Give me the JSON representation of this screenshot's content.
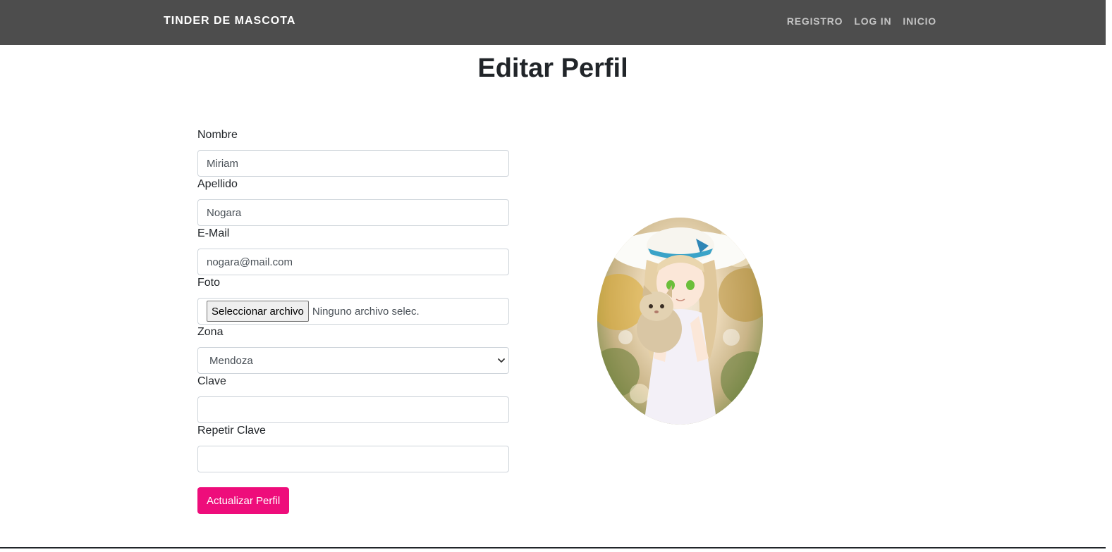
{
  "navbar": {
    "brand": "TINDER DE MASCOTA",
    "links": [
      "REGISTRO",
      "LOG IN",
      "INICIO"
    ]
  },
  "page_title": "Editar Perfil",
  "form": {
    "nombre": {
      "label": "Nombre",
      "value": "Miriam"
    },
    "apellido": {
      "label": "Apellido",
      "value": "Nogara"
    },
    "email": {
      "label": "E-Mail",
      "value": "nogara@mail.com"
    },
    "foto": {
      "label": "Foto",
      "button_label": "Seleccionar archivo",
      "status": "Ninguno archivo selec."
    },
    "zona": {
      "label": "Zona",
      "value": "Mendoza"
    },
    "clave": {
      "label": "Clave",
      "value": ""
    },
    "repetir_clave": {
      "label": "Repetir Clave",
      "value": ""
    },
    "submit_label": "Actualizar Perfil"
  },
  "colors": {
    "navbar_bg": "#4d4d4d",
    "accent": "#ee0d7b"
  },
  "icons": {
    "select_arrow": "chevron-down-icon"
  }
}
